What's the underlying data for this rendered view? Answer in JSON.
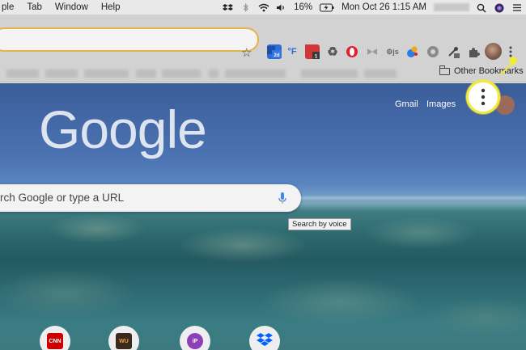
{
  "menubar": {
    "menus": [
      "ple",
      "Tab",
      "Window",
      "Help"
    ],
    "battery": "16%",
    "datetime": "Mon Oct 26  1:15 AM"
  },
  "toolbar": {
    "extensions": [
      {
        "name": "2d",
        "color": "#2e6bd6"
      },
      {
        "name": "°F",
        "color": "#ffffff"
      },
      {
        "name": "1",
        "color": "#d23636"
      },
      {
        "name": "recycle",
        "color": "#5d5d5d"
      },
      {
        "name": "opera",
        "color": "#e0202a"
      }
    ],
    "other_bookmarks": "Other Bookmarks"
  },
  "page": {
    "links": {
      "gmail": "Gmail",
      "images": "Images"
    },
    "logo": "Google",
    "search_placeholder": "rch Google or type a URL",
    "voice_tooltip": "Search by voice",
    "shortcuts": [
      {
        "label": "CNN",
        "color": "#cc0000"
      },
      {
        "label": "WU",
        "color": "#8b4d22"
      },
      {
        "label": "iP",
        "color": "#8b3fb8"
      },
      {
        "label": "dropbox",
        "color": "#0061fe"
      }
    ]
  }
}
